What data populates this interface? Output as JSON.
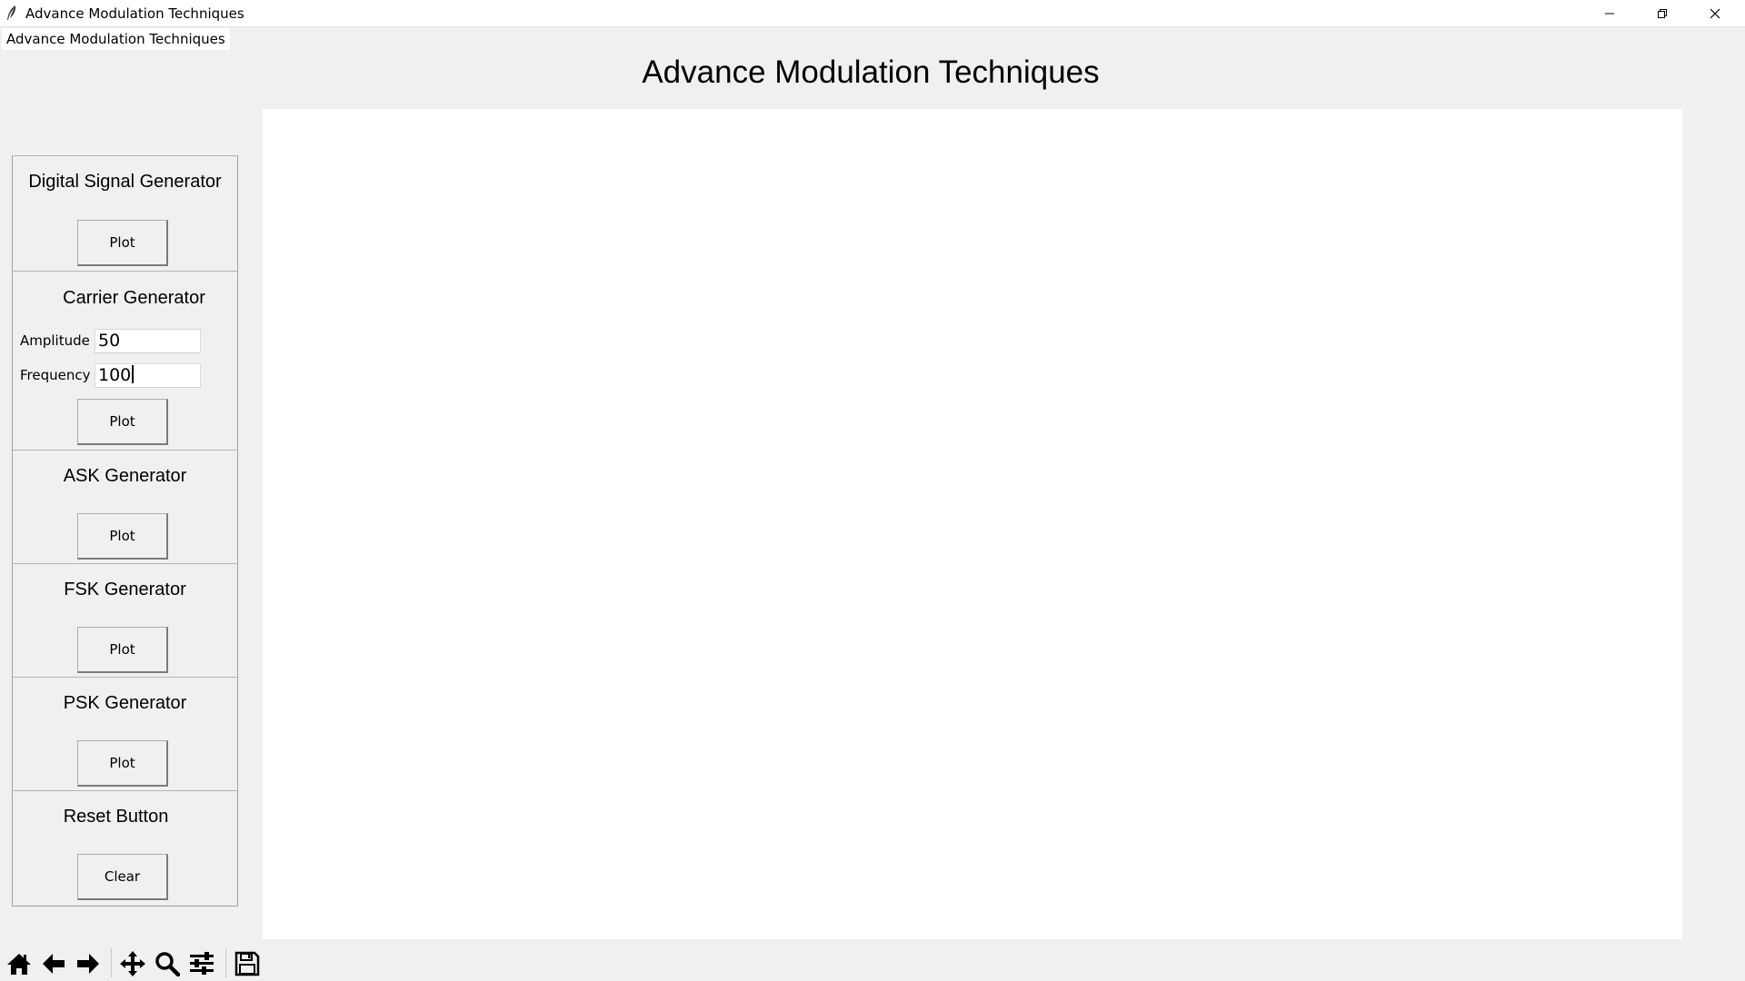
{
  "window": {
    "title": "Advance Modulation Techniques"
  },
  "tab": {
    "label": "Advance Modulation Techniques"
  },
  "page": {
    "title": "Advance Modulation Techniques"
  },
  "sections": {
    "digital": {
      "title": "Digital Signal Generator",
      "button": "Plot"
    },
    "carrier": {
      "title": "Carrier Generator",
      "amplitude_label": "Amplitude",
      "amplitude_value": "50",
      "frequency_label": "Frequency",
      "frequency_value": "100",
      "button": "Plot"
    },
    "ask": {
      "title": "ASK Generator",
      "button": "Plot"
    },
    "fsk": {
      "title": "FSK Generator",
      "button": "Plot"
    },
    "psk": {
      "title": "PSK Generator",
      "button": "Plot"
    },
    "reset": {
      "title": "Reset Button",
      "button": "Clear"
    }
  },
  "toolbar": {
    "icons": [
      "home-icon",
      "back-arrow-icon",
      "forward-arrow-icon",
      "pan-icon",
      "zoom-icon",
      "configure-subplots-icon",
      "save-icon"
    ]
  },
  "colors": {
    "background": "#f0f0f0",
    "canvas": "#ffffff",
    "titlebar": "#ffffff"
  }
}
